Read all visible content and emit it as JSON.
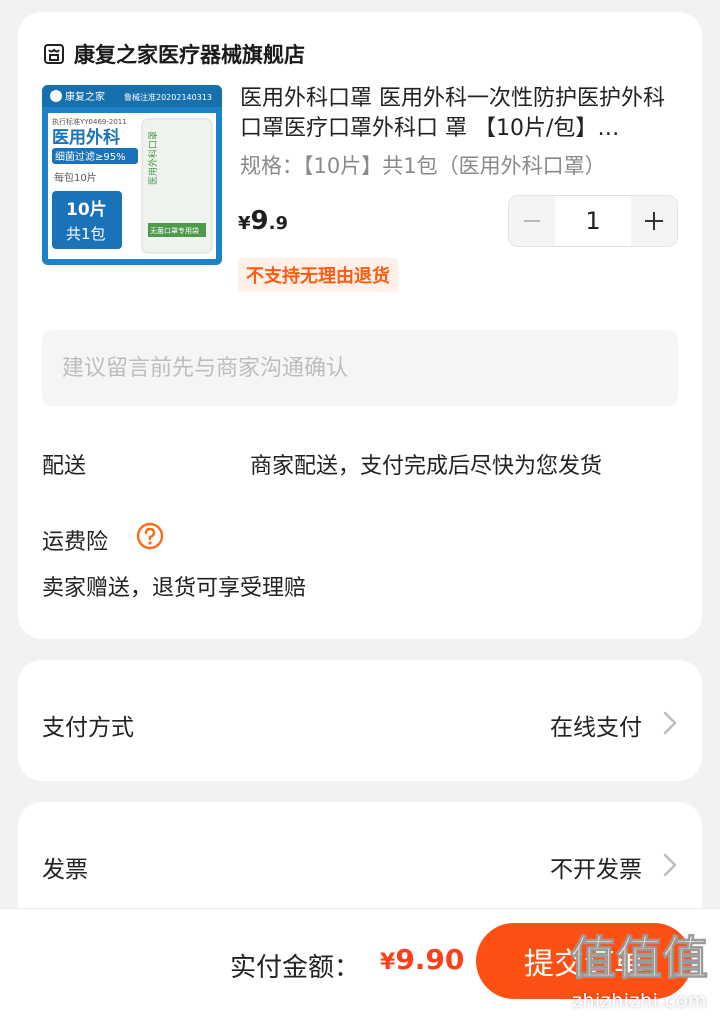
{
  "store": {
    "name": "康复之家医疗器械旗舰店",
    "icon": "store-icon"
  },
  "product": {
    "title": "医用外科口罩 医用外科一次性防护医护外科口罩医疗口罩外科口 罩 【10片/包】…",
    "spec": "规格：【10片】共1包（医用外科口罩）",
    "price_currency": "¥",
    "price_int": "9",
    "price_dec": ".9",
    "quantity": "1",
    "no_return_badge": "不支持无理由退货",
    "image": {
      "brand": "康复之家",
      "reg_no": "鲁械注准20202140313",
      "standard": "执行标准YY0469-2011",
      "headline": "医用外科",
      "filter": "细菌过滤≥95%",
      "per_pack": "每包10片",
      "count_line1": "10片",
      "count_line2": "共1包",
      "pack_text": "医用外科口罩",
      "pack_label": "无菌口罩专用袋"
    }
  },
  "memo": {
    "placeholder": "建议留言前先与商家沟通确认"
  },
  "delivery": {
    "label": "配送",
    "value": "商家配送，支付完成后尽快为您发货"
  },
  "insurance": {
    "label": "运费险",
    "desc": "卖家赠送，退货可享受理赔",
    "icon": "help-icon"
  },
  "payment": {
    "label": "支付方式",
    "value": "在线支付"
  },
  "invoice": {
    "label": "发票",
    "value": "不开发票"
  },
  "footer": {
    "total_label": "实付金额：",
    "total_currency": "¥",
    "total_value": "9.90",
    "submit_label": "提交订单"
  },
  "watermark": {
    "text": "zhizhizhi.com",
    "glyphs": "值值值"
  },
  "colors": {
    "accent": "#ff5014",
    "price": "#ff3f1a",
    "badge_bg": "#fff0e8",
    "badge_text": "#ff5b14"
  }
}
